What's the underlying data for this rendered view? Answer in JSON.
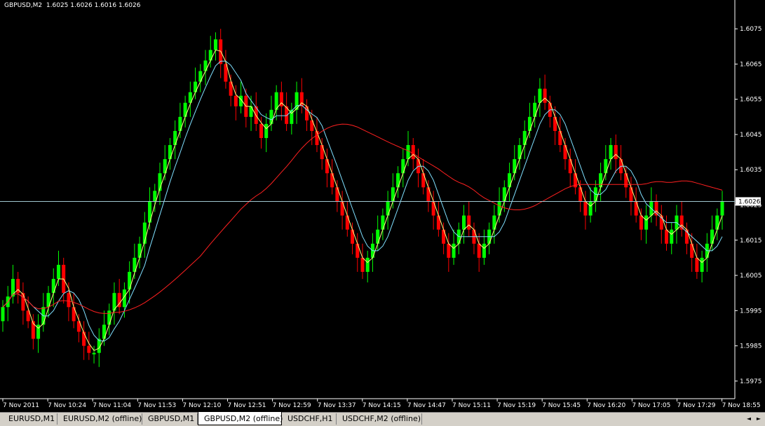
{
  "chart": {
    "symbol": "GBPUSD,M2",
    "ohlc": "1.6025 1.6026 1.6016 1.6026",
    "current_price": "1.6026",
    "colors": {
      "background": "#000000",
      "bull": "#00ff00",
      "bear": "#ff0000",
      "axis": "#ffffff",
      "ma_fast": "#ffff80",
      "ma_slow": "#7fe0ff",
      "ma_long": "#ff2020",
      "price_line": "#a0c8d0"
    }
  },
  "chart_data": {
    "type": "candlestick",
    "ylim": [
      1.597,
      1.608
    ],
    "y_ticks": [
      "1.6075",
      "1.6065",
      "1.6055",
      "1.6045",
      "1.6035",
      "1.6025",
      "1.6015",
      "1.6005",
      "1.5995",
      "1.5985",
      "1.5975"
    ],
    "x_ticks": [
      "7 Nov 2011",
      "7 Nov 10:24",
      "7 Nov 11:04",
      "7 Nov 11:53",
      "7 Nov 12:10",
      "7 Nov 12:51",
      "7 Nov 12:59",
      "7 Nov 13:37",
      "7 Nov 14:15",
      "7 Nov 14:47",
      "7 Nov 15:11",
      "7 Nov 15:19",
      "7 Nov 15:45",
      "7 Nov 16:20",
      "7 Nov 17:05",
      "7 Nov 17:29",
      "7 Nov 18:55"
    ],
    "close": [
      1.5996,
      1.5999,
      1.6004,
      1.6,
      1.5995,
      1.5992,
      1.5987,
      1.5991,
      1.5996,
      1.6,
      1.6004,
      1.6008,
      1.6,
      1.5996,
      1.5992,
      1.5989,
      1.5985,
      1.5983,
      1.5983,
      1.5987,
      1.5991,
      1.5995,
      1.6,
      1.5996,
      1.6001,
      1.6006,
      1.601,
      1.6014,
      1.602,
      1.6026,
      1.6029,
      1.6034,
      1.6038,
      1.6042,
      1.6046,
      1.605,
      1.6054,
      1.6057,
      1.606,
      1.6063,
      1.6066,
      1.6069,
      1.6072,
      1.6065,
      1.606,
      1.6056,
      1.6053,
      1.6056,
      1.605,
      1.6053,
      1.6048,
      1.6044,
      1.6048,
      1.6052,
      1.6057,
      1.6053,
      1.6048,
      1.6052,
      1.6057,
      1.6053,
      1.6049,
      1.6046,
      1.6042,
      1.6038,
      1.6034,
      1.603,
      1.6026,
      1.6022,
      1.6018,
      1.6014,
      1.601,
      1.6006,
      1.601,
      1.6014,
      1.6018,
      1.6022,
      1.6026,
      1.603,
      1.6034,
      1.6038,
      1.6042,
      1.6038,
      1.6034,
      1.603,
      1.6026,
      1.6022,
      1.6018,
      1.6014,
      1.601,
      1.6014,
      1.6018,
      1.6022,
      1.6018,
      1.6014,
      1.601,
      1.6014,
      1.6018,
      1.6022,
      1.6026,
      1.603,
      1.6034,
      1.6038,
      1.6042,
      1.6046,
      1.605,
      1.6054,
      1.6058,
      1.6054,
      1.605,
      1.6046,
      1.6042,
      1.6038,
      1.6034,
      1.603,
      1.6026,
      1.6022,
      1.6026,
      1.603,
      1.6034,
      1.6038,
      1.6042,
      1.6038,
      1.6034,
      1.603,
      1.6026,
      1.6022,
      1.6018,
      1.6022,
      1.6026,
      1.6022,
      1.6018,
      1.6014,
      1.6018,
      1.6022,
      1.6018,
      1.6014,
      1.601,
      1.6006,
      1.601,
      1.6014,
      1.6018,
      1.6022,
      1.6026
    ]
  },
  "tabs": [
    {
      "label": "EURUSD,M1",
      "active": false
    },
    {
      "label": "EURUSD,M2 (offline)",
      "active": false
    },
    {
      "label": "GBPUSD,M1",
      "active": false
    },
    {
      "label": "GBPUSD,M2 (offline)",
      "active": true
    },
    {
      "label": "USDCHF,H1",
      "active": false
    },
    {
      "label": "USDCHF,M2 (offline)",
      "active": false
    }
  ],
  "tab_nav": {
    "prev": "◄",
    "next": "►"
  }
}
